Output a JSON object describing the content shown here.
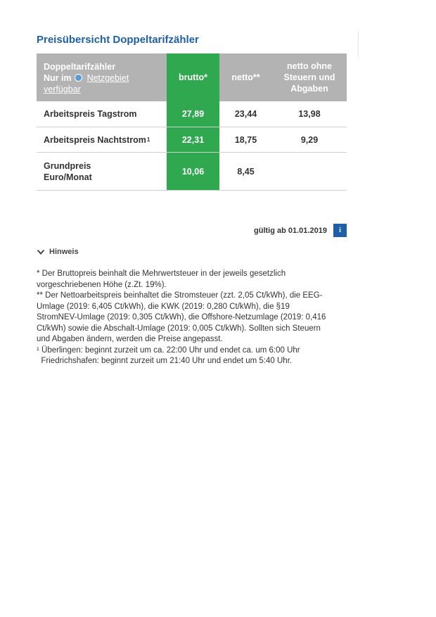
{
  "title": "Preisübersicht Doppeltarifzähler",
  "table": {
    "header": {
      "col1_line1": "Doppeltarifzähler",
      "col1_prefix": "Nur im",
      "col1_link": "Netzgebiet",
      "col1_link2": "verfügbar",
      "brutto": "brutto*",
      "netto": "netto**",
      "netto_ohne": "netto ohne Steuern und Abgaben"
    },
    "rows": [
      {
        "label": "Arbeitspreis Tagstrom",
        "sup": "",
        "brutto": "27,89",
        "netto": "23,44",
        "netto_ohne": "13,98"
      },
      {
        "label": "Arbeitspreis Nachtstrom",
        "sup": "1",
        "brutto": "22,31",
        "netto": "18,75",
        "netto_ohne": "9,29"
      },
      {
        "label_line1": "Grundpreis",
        "label_line2": "Euro/Monat",
        "brutto": "10,06",
        "netto": "8,45",
        "netto_ohne": ""
      }
    ]
  },
  "valid_from": "gültig ab 01.01.2019",
  "info_button": "i",
  "hint": {
    "label": "Hinweis",
    "icon": "chevron-down-icon"
  },
  "notes": [
    "* Der Bruttopreis beinhalt die Mehrwertsteuer in der jeweils gesetzlich vorgeschriebenen Höhe (z.Zt. 19%).",
    "** Der Nettoarbeitspreis beinhaltet die Stromsteuer (zzt. 2,05 Ct/kWh), die EEG-Umlage (2019: 6,405 Ct/kWh), die KWK (2019: 0,280 Ct/kWh), die §19 StromNEV-Umlage (2019: 0,305 Ct/kWh), die Offshore-Netzumlage (2019: 0,416 Ct/kWh) sowie die Abschalt-Umlage (2019: 0,005 Ct/kWh). Sollten sich Steuern und Abgaben ändern, werden die Preise angepasst.",
    "¹ Überlingen: beginnt zurzeit um ca. 22:00 Uhr und endet ca. um 6:00 Uhr",
    "  Friedrichshafen: beginnt zurzeit um 21:40 Uhr und endet um 5:40 Uhr."
  ],
  "colors": {
    "title": "#1f5fa8",
    "brutto_column": "#2fa84f",
    "header_bg": "#b3b3b3",
    "info_button": "#1f5fa8"
  }
}
